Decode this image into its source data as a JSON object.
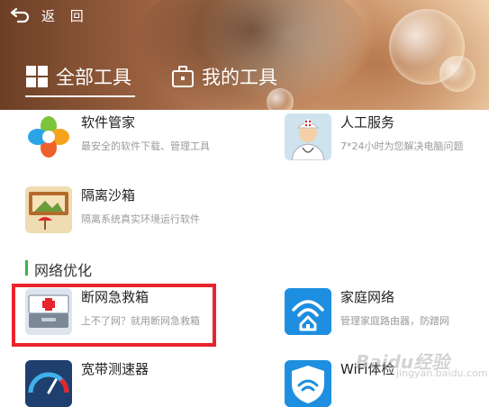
{
  "nav": {
    "back_label": "返 回"
  },
  "tabs": [
    {
      "label": "全部工具",
      "icon": "grid-icon",
      "active": true
    },
    {
      "label": "我的工具",
      "icon": "toolbox-icon",
      "active": false
    }
  ],
  "tools": [
    {
      "name": "软件管家",
      "desc": "最安全的软件下载、管理工具",
      "icon": "software-manager-icon"
    },
    {
      "name": "人工服务",
      "desc": "7*24小时为您解决电脑问题",
      "icon": "doctor-icon"
    },
    {
      "name": "隔离沙箱",
      "desc": "隔离系统真实环境运行软件",
      "icon": "sandbox-icon"
    }
  ],
  "section": {
    "title": "网络优化"
  },
  "network_tools": [
    {
      "name": "断网急救箱",
      "desc": "上不了网？就用断网急救箱",
      "icon": "first-aid-kit-icon"
    },
    {
      "name": "家庭网络",
      "desc": "管理家庭路由器，防蹭网",
      "icon": "home-wifi-icon"
    },
    {
      "name": "宽带测速器",
      "icon": "speedometer-icon"
    },
    {
      "name": "WiFi体检",
      "icon": "wifi-shield-icon"
    }
  ],
  "watermark": {
    "text": "Baidu经验",
    "sub": "jingyan.baidu.com"
  },
  "colors": {
    "section_accent": "#3fb14b",
    "highlight": "#e8242c"
  }
}
